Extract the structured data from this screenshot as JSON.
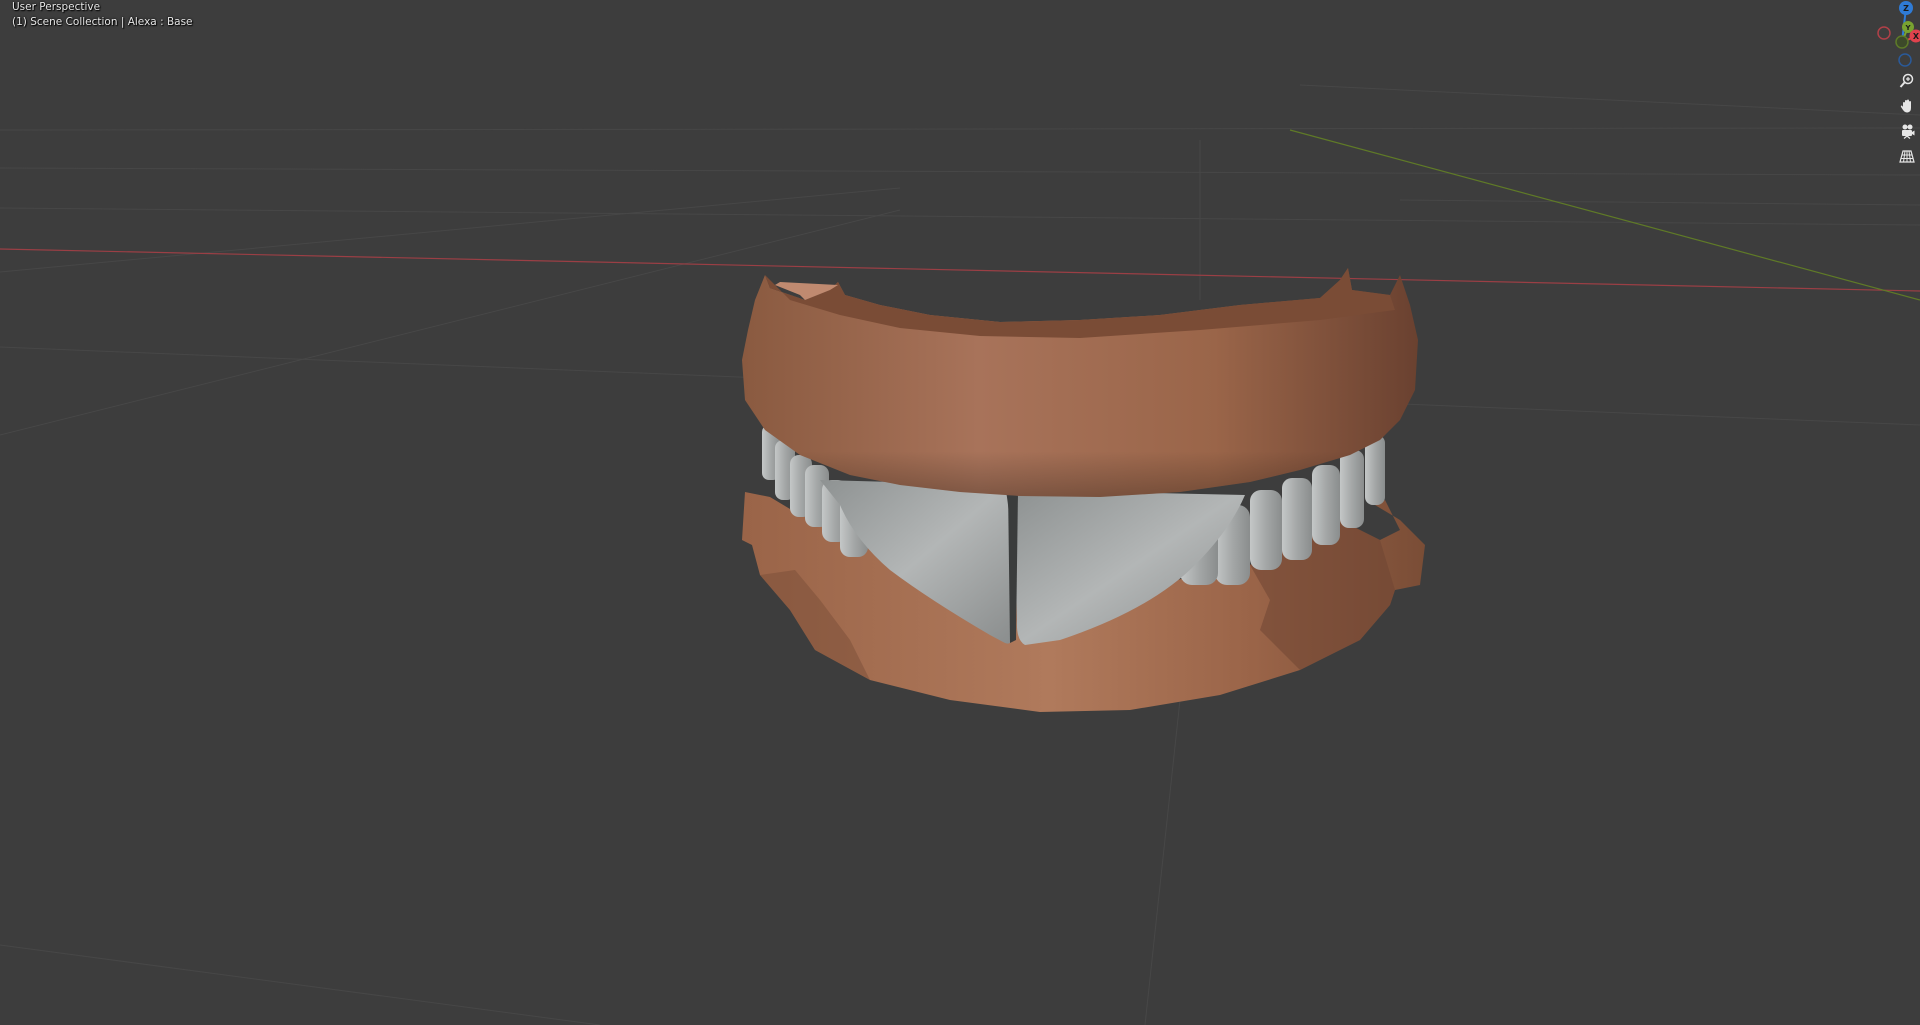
{
  "viewport": {
    "view_mode": "User Perspective",
    "collection_info": "(1) Scene Collection | Alexa : Base",
    "background_color": "#3d3d3d",
    "grid_color": "#4a4a4a",
    "x_axis_color": "#a04046",
    "y_axis_color": "#6d8a2a"
  },
  "gizmo": {
    "axes": [
      {
        "name": "z-axis-ball",
        "label": "Z",
        "color": "#2f7bd6"
      },
      {
        "name": "y-axis-ball",
        "label": "Y",
        "color": "#79a230"
      },
      {
        "name": "x-axis-ball",
        "label": "X",
        "color": "#e0424d"
      },
      {
        "name": "neg-x-axis-ball",
        "label": "",
        "color": "#b04048"
      },
      {
        "name": "neg-y-axis-ball",
        "label": "",
        "color": "#5d7a28"
      },
      {
        "name": "neg-z-axis-ball",
        "label": "",
        "color": "#2a5a9a"
      }
    ]
  },
  "nav_buttons": [
    {
      "name": "zoom-icon",
      "icon": "magnifier-plus"
    },
    {
      "name": "pan-hand-icon",
      "icon": "hand"
    },
    {
      "name": "camera-view-icon",
      "icon": "camera"
    },
    {
      "name": "perspective-grid-icon",
      "icon": "grid"
    }
  ],
  "model": {
    "gum_color": "#a06a4c",
    "gum_shadow": "#6e4330",
    "teeth_color": "#a9acac",
    "teeth_shadow": "#7f8282"
  }
}
